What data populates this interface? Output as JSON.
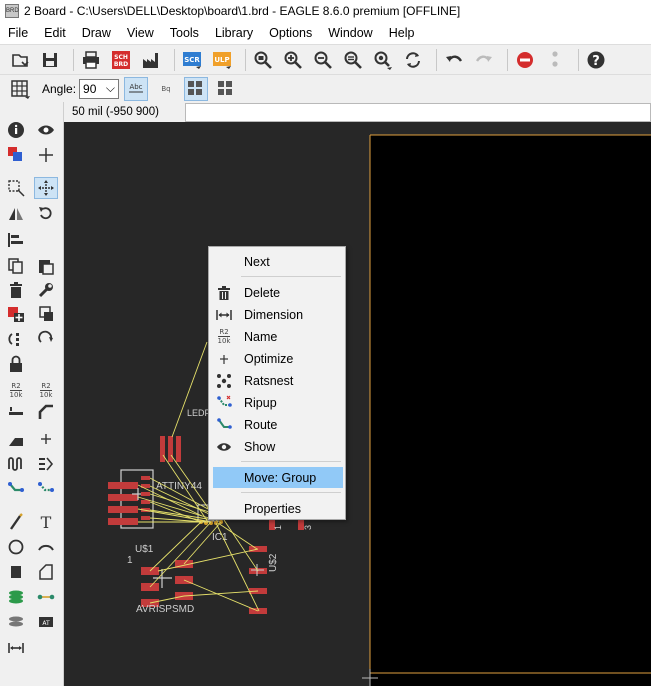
{
  "window": {
    "title": "2 Board - C:\\Users\\DELL\\Desktop\\board\\1.brd - EAGLE 8.6.0 premium [OFFLINE]",
    "app_icon": "BRD"
  },
  "menu": [
    "File",
    "Edit",
    "Draw",
    "View",
    "Tools",
    "Library",
    "Options",
    "Window",
    "Help"
  ],
  "toolbar1": {
    "icons": [
      "open-icon",
      "save-icon",
      "print-icon",
      "sch-brd-switch-icon",
      "cam-icon",
      "script-icon",
      "ulp-icon",
      "zoom-fit-icon",
      "zoom-in-icon",
      "zoom-out-icon",
      "zoom-redraw-icon",
      "zoom-select-icon",
      "redraw-icon",
      "undo-icon",
      "redo-icon",
      "stop-icon",
      "go-icon",
      "help-icon"
    ],
    "sch_label_top": "SCH",
    "sch_label_bottom": "BRD",
    "scr_label": "SCR",
    "ulp_label": "ULP"
  },
  "toolbar2": {
    "angle_label": "Angle:",
    "angle_value": "90",
    "abc_label": "Abc",
    "sq_label": "Bq"
  },
  "coord": {
    "text": "50 mil (-950 900)"
  },
  "context_menu": {
    "items": [
      {
        "label": "Next",
        "icon": ""
      },
      {
        "label": "Delete",
        "icon": "trash-icon"
      },
      {
        "label": "Dimension",
        "icon": "dimension-icon"
      },
      {
        "label": "Name",
        "icon": "name-icon",
        "icon_text_top": "R2",
        "icon_text_bottom": "10k"
      },
      {
        "label": "Optimize",
        "icon": "optimize-icon"
      },
      {
        "label": "Ratsnest",
        "icon": "ratsnest-icon"
      },
      {
        "label": "Ripup",
        "icon": "ripup-icon"
      },
      {
        "label": "Route",
        "icon": "route-icon"
      },
      {
        "label": "Show",
        "icon": "eye-icon"
      },
      {
        "label": "Move: Group",
        "icon": ""
      },
      {
        "label": "Properties",
        "icon": ""
      }
    ],
    "highlighted": "Move: Group"
  },
  "canvas": {
    "labels": {
      "led": "LEDF",
      "attiny": "ATTINY44",
      "ic1": "IC1",
      "u1": "U$1",
      "u2": "U$2",
      "avrisp": "AVRISPSMD",
      "pin1_left": "1",
      "pin1_right": "1",
      "pin3": "3"
    },
    "colors": {
      "background": "#272727",
      "pad": "#c23b3b",
      "airwire": "#e5e06a",
      "silk": "#cfcfcf",
      "dimension": "#e1a03f",
      "black_area": "#000000"
    }
  },
  "left_toolbar": {
    "text_tool_label": "T",
    "rk_text_top": "R2",
    "rk_text_bottom": "10k",
    "icons": [
      "info-icon",
      "eye-icon",
      "layer-icon",
      "mark-icon",
      "group-icon",
      "move-icon",
      "mirror-icon",
      "rotate-icon",
      "align-icon",
      "copy-icon",
      "paste-icon",
      "delete-icon",
      "wrench-icon",
      "add-icon",
      "replace-icon",
      "swap-icon",
      "change-icon",
      "lock-icon",
      "name-icon",
      "value-icon",
      "smash-icon",
      "miter-icon",
      "split-icon",
      "optimize-icon",
      "meander-icon",
      "layers-icon",
      "route-icon",
      "ripup-icon",
      "wire-icon",
      "text-icon",
      "circle-icon",
      "arc-icon",
      "rect-icon",
      "polygon-icon",
      "via-icon",
      "signal-icon",
      "hole-icon",
      "attribute-icon",
      "dimension-icon"
    ]
  }
}
